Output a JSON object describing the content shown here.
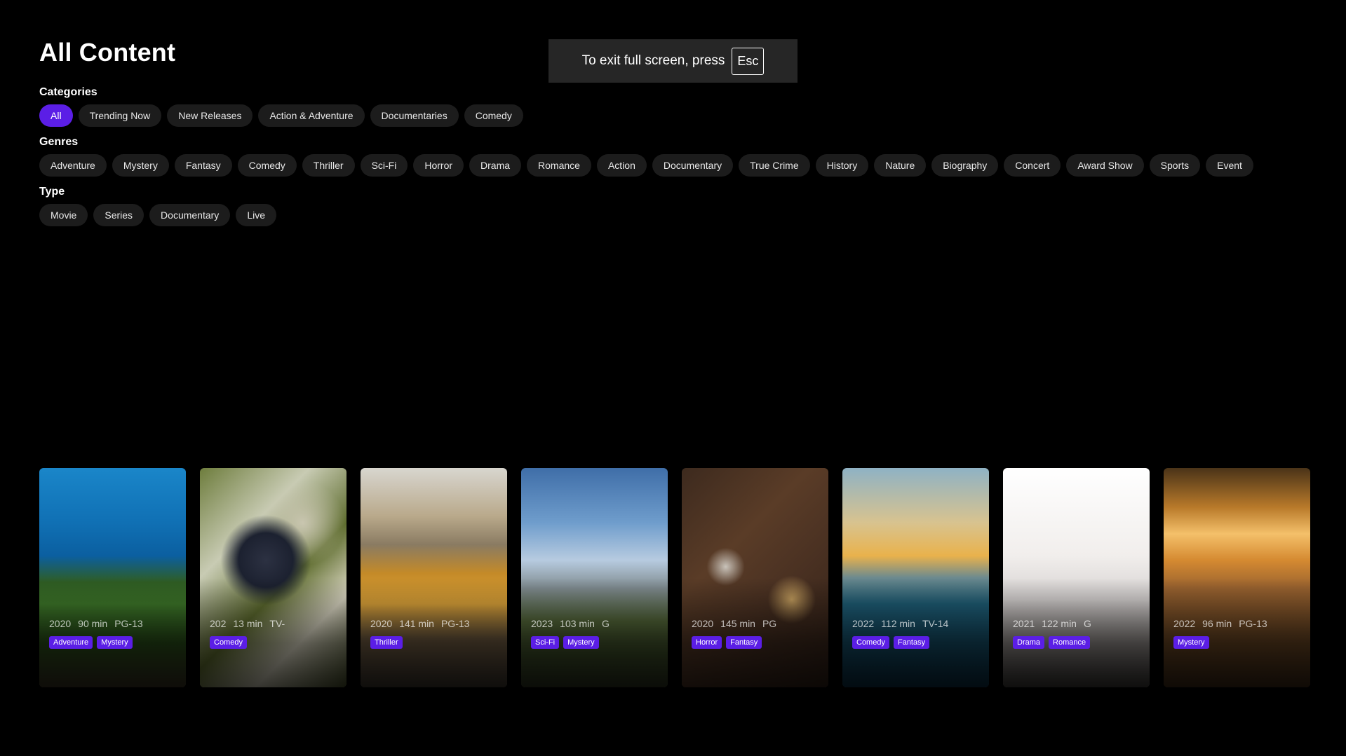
{
  "page": {
    "title": "All Content"
  },
  "toast": {
    "text": "To exit full screen, press",
    "key": "Esc"
  },
  "filters": {
    "categories": {
      "label": "Categories",
      "items": [
        "All",
        "Trending Now",
        "New Releases",
        "Action & Adventure",
        "Documentaries",
        "Comedy"
      ],
      "selected": "All"
    },
    "genres": {
      "label": "Genres",
      "items": [
        "Adventure",
        "Mystery",
        "Fantasy",
        "Comedy",
        "Thriller",
        "Sci-Fi",
        "Horror",
        "Drama",
        "Romance",
        "Action",
        "Documentary",
        "True Crime",
        "History",
        "Nature",
        "Biography",
        "Concert",
        "Award Show",
        "Sports",
        "Event"
      ]
    },
    "type": {
      "label": "Type",
      "items": [
        "Movie",
        "Series",
        "Documentary",
        "Live"
      ]
    }
  },
  "colors": {
    "accent": "#5b1ee6",
    "chip_bg": "#1c1c1c",
    "background": "#000000"
  },
  "cards": [
    {
      "year": "2020",
      "duration": "90 min",
      "rating": "PG-13",
      "tags": [
        "Adventure",
        "Mystery"
      ]
    },
    {
      "year": "202",
      "duration": "13 min",
      "rating": "TV-",
      "tags": [
        "Comedy"
      ]
    },
    {
      "year": "2020",
      "duration": "141 min",
      "rating": "PG-13",
      "tags": [
        "Thriller"
      ]
    },
    {
      "year": "2023",
      "duration": "103 min",
      "rating": "G",
      "tags": [
        "Sci-Fi",
        "Mystery"
      ]
    },
    {
      "year": "2020",
      "duration": "145 min",
      "rating": "PG",
      "tags": [
        "Horror",
        "Fantasy"
      ]
    },
    {
      "year": "2022",
      "duration": "112 min",
      "rating": "TV-14",
      "tags": [
        "Comedy",
        "Fantasy"
      ]
    },
    {
      "year": "2021",
      "duration": "122 min",
      "rating": "G",
      "tags": [
        "Drama",
        "Romance"
      ]
    },
    {
      "year": "2022",
      "duration": "96 min",
      "rating": "PG-13",
      "tags": [
        "Mystery"
      ]
    }
  ]
}
